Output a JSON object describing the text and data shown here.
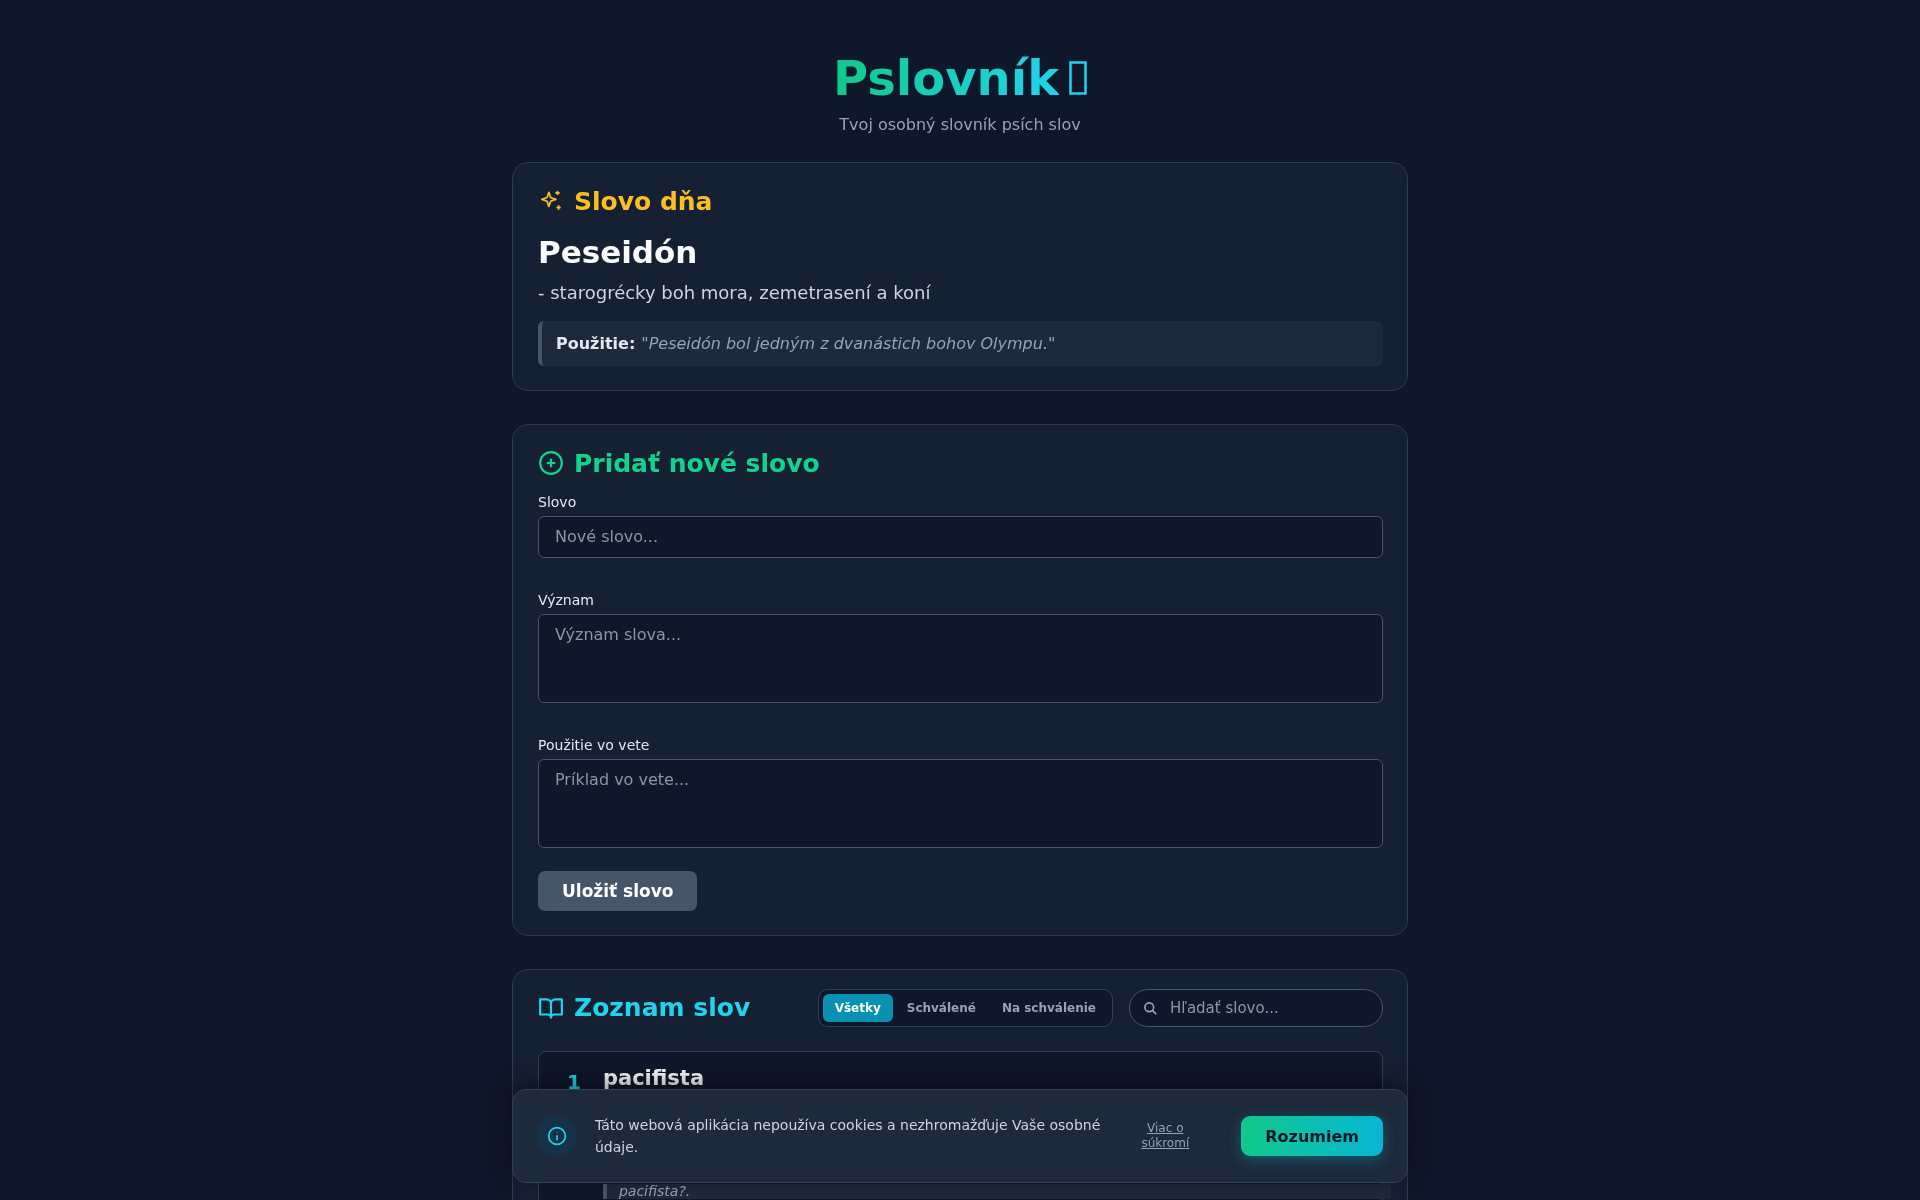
{
  "header": {
    "title": "Pslovník",
    "subtitle": "Tvoj osobný slovník psích slov"
  },
  "word_of_day": {
    "heading": "Slovo dňa",
    "word": "Peseidón",
    "definition": "- starogrécky boh mora, zemetrasení a koní",
    "usage_label": "Použitie:",
    "usage": "\"Peseidón bol jedným z dvanástich bohov Olympu.\""
  },
  "add_form": {
    "heading": "Pridať nové slovo",
    "fields": [
      {
        "kind": "input",
        "label": "Slovo",
        "placeholder": "Nové slovo..."
      },
      {
        "kind": "textarea",
        "label": "Význam",
        "placeholder": "Význam slova..."
      },
      {
        "kind": "textarea",
        "label": "Použitie vo vete",
        "placeholder": "Príklad vo vete..."
      }
    ],
    "submit": "Uložiť slovo"
  },
  "word_list": {
    "heading": "Zoznam slov",
    "filters": [
      {
        "label": "Všetky",
        "selected": true
      },
      {
        "label": "Schválené",
        "selected": false
      },
      {
        "label": "Na schválenie",
        "selected": false
      }
    ],
    "search": {
      "placeholder": "Hľadať slovo..."
    },
    "items": [
      {
        "number": "1",
        "word": "pacifista",
        "usage": "pacifista?."
      }
    ]
  },
  "cookie_banner": {
    "message": "Táto webová aplikácia nepoužíva cookies a nezhromažďuje Vaše osobné údaje.",
    "link": "Viac o súkromí",
    "button": "Rozumiem"
  }
}
